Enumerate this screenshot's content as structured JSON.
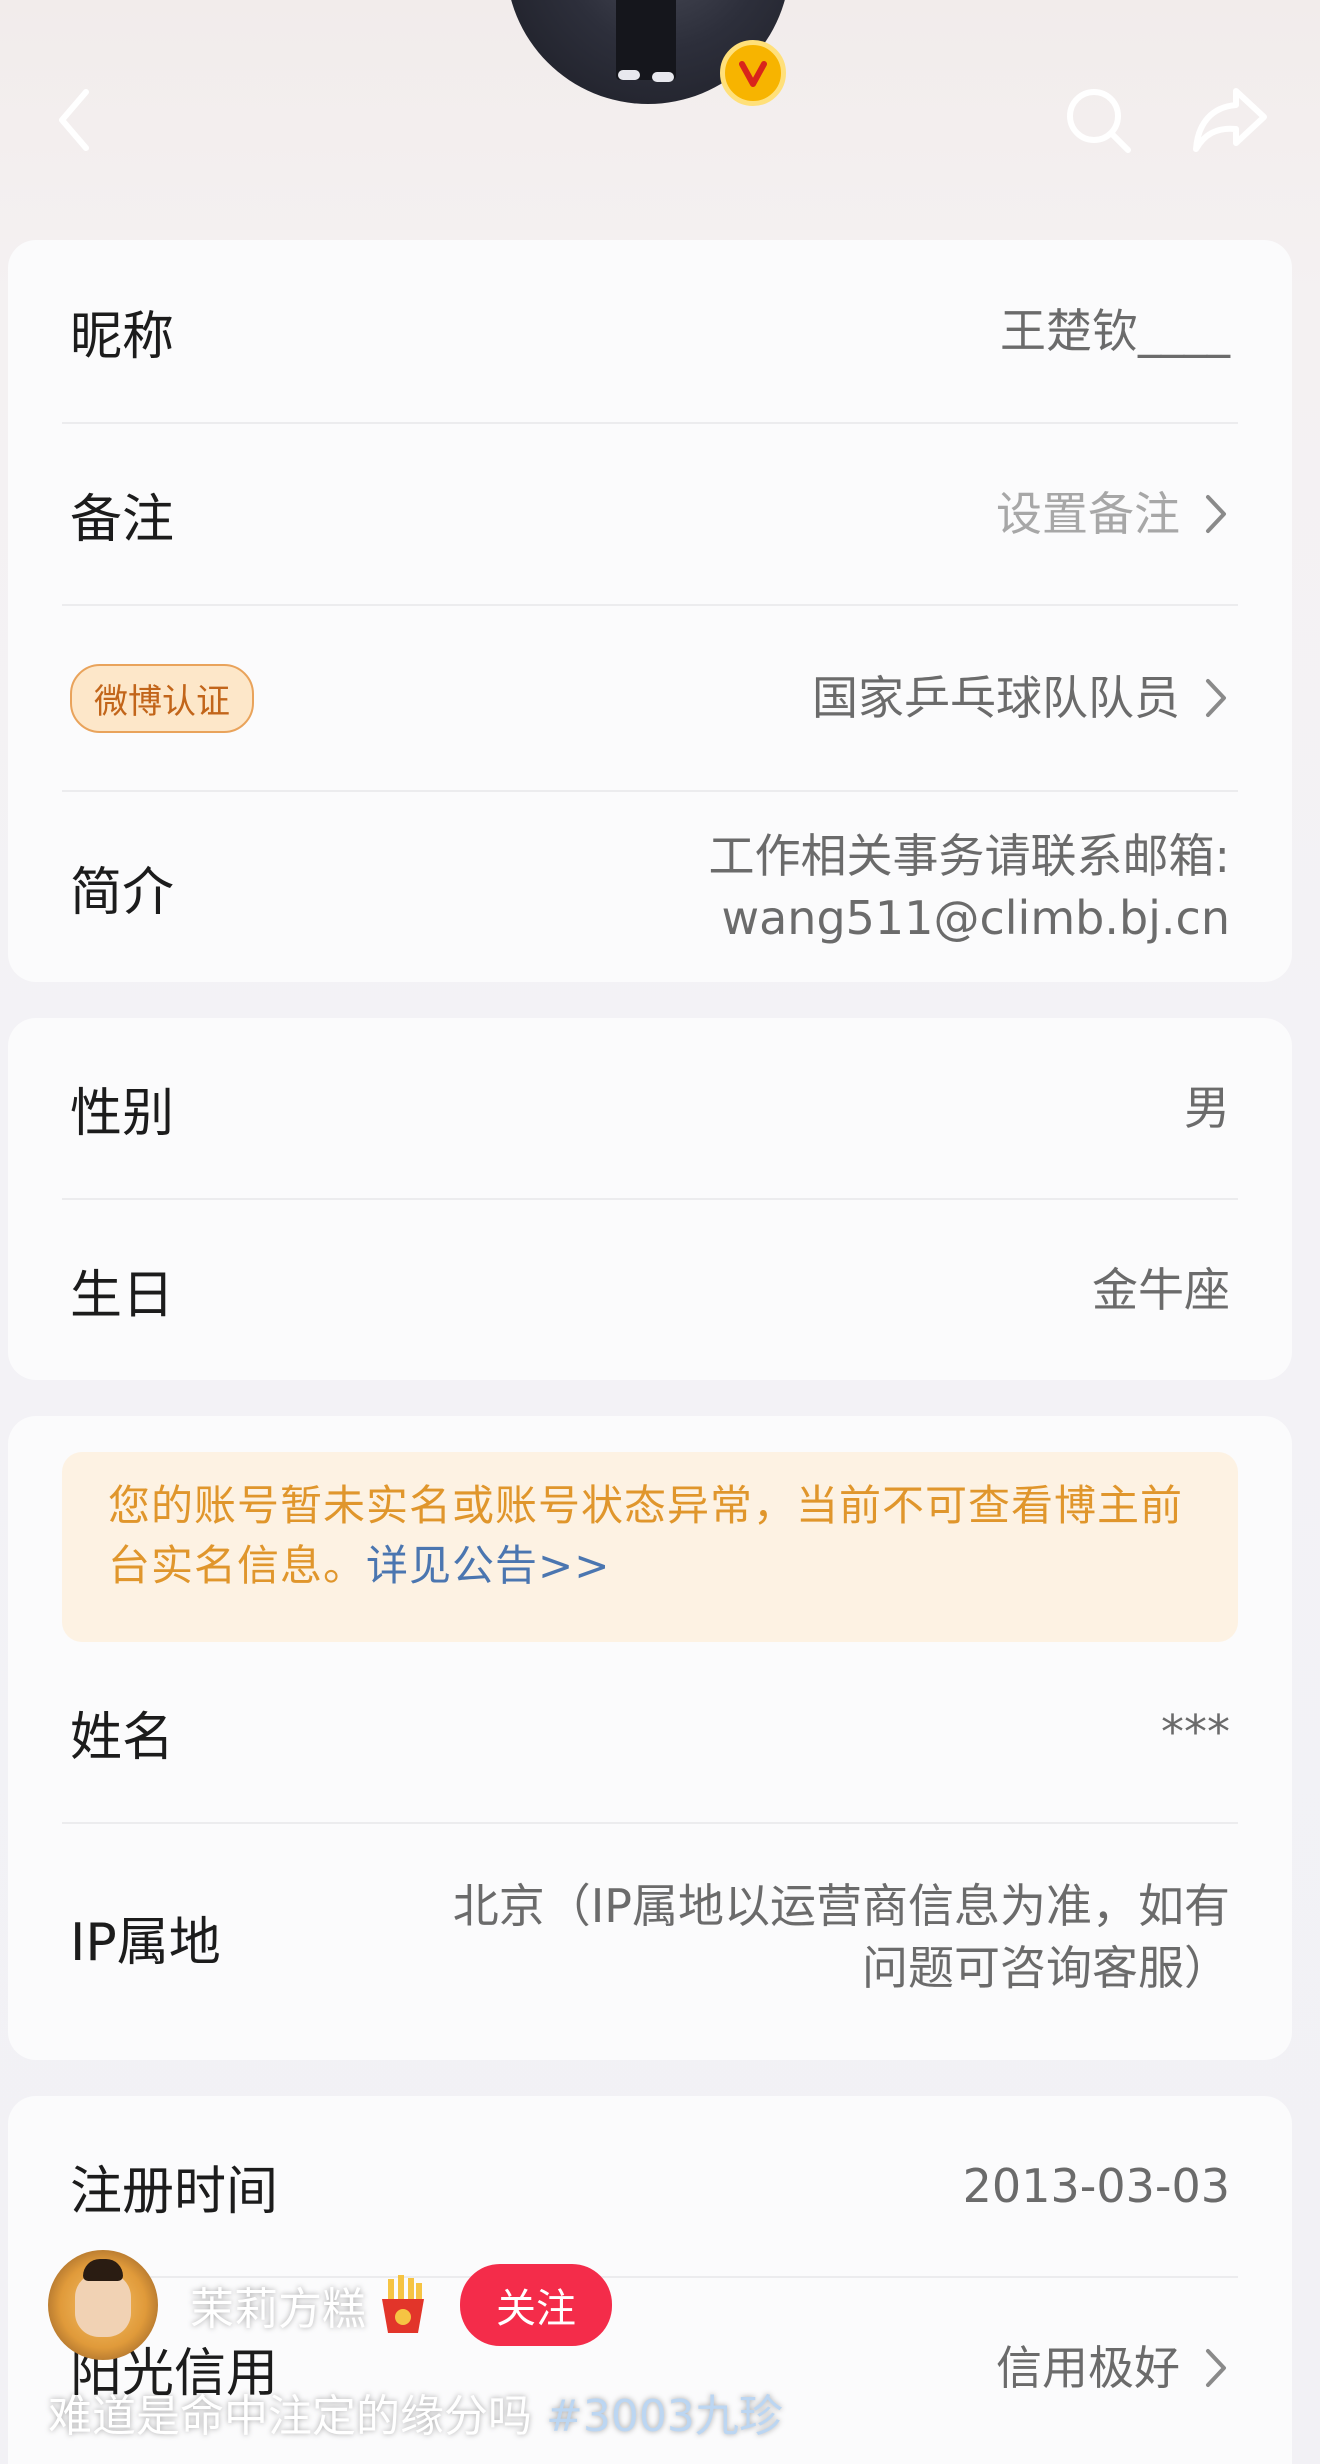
{
  "header": {
    "back_icon": "chevron-left-icon",
    "search_icon": "search-icon",
    "share_icon": "share-icon",
    "verified_badge_icon": "verified-v-icon"
  },
  "basic": {
    "nickname_label": "昵称",
    "nickname_value": "王楚钦____",
    "remark_label": "备注",
    "remark_value": "设置备注",
    "verify_badge": "微博认证",
    "verify_value": "国家乒乓球队队员",
    "bio_label": "简介",
    "bio_line1": "工作相关事务请联系邮箱:",
    "bio_line2": "wang511@climb.bj.cn"
  },
  "personal": {
    "gender_label": "性别",
    "gender_value": "男",
    "birthday_label": "生日",
    "birthday_value": "金牛座"
  },
  "realname": {
    "notice_text": "您的账号暂未实名或账号状态异常，当前不可查看博主前台实名信息。",
    "notice_link": "详见公告>>",
    "name_label": "姓名",
    "name_value": "***",
    "ip_label": "IP属地",
    "ip_line1": "北京（IP属地以运营商信息为准，如有",
    "ip_line2": "问题可咨询客服）"
  },
  "account": {
    "register_label": "注册时间",
    "register_value": "2013-03-03",
    "credit_label": "阳光信用",
    "credit_value": "信用极好"
  },
  "overlay": {
    "username": "茉莉方糕",
    "follow_label": "关注",
    "caption": "难道是命中注定的缘分吗",
    "hashtag": "#3003九珍"
  },
  "colors": {
    "accent_red": "#f42c4a",
    "notice_orange": "#e0962c",
    "link_blue": "#4b76b0",
    "badge_gold": "#f7b400"
  }
}
